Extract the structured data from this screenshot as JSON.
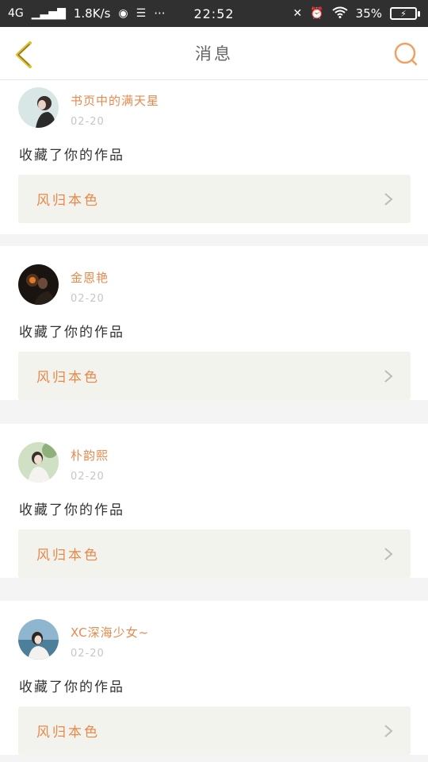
{
  "status_bar": {
    "network": "4G",
    "speed": "1.8K/s",
    "more": "···",
    "time": "22:52",
    "battery": "35%"
  },
  "nav": {
    "title": "消息",
    "back_icon": "chevron-left-icon",
    "search_icon": "search-icon"
  },
  "messages": [
    {
      "username": "书页中的满天星",
      "date": "02-20",
      "action": "收藏了你的作品",
      "work_title": "风归本色",
      "avatar": "avatar-1"
    },
    {
      "username": "金恩艳",
      "date": "02-20",
      "action": "收藏了你的作品",
      "work_title": "风归本色",
      "avatar": "avatar-2"
    },
    {
      "username": "朴韵熙",
      "date": "02-20",
      "action": "收藏了你的作品",
      "work_title": "风归本色",
      "avatar": "avatar-3"
    },
    {
      "username": "XC深海少女~",
      "date": "02-20",
      "action": "收藏了你的作品",
      "work_title": "风归本色",
      "avatar": "avatar-4"
    }
  ],
  "colors": {
    "accent": "#e8894c",
    "back_arrow": "#e0c030",
    "work_box_bg": "#f2f3ec"
  }
}
